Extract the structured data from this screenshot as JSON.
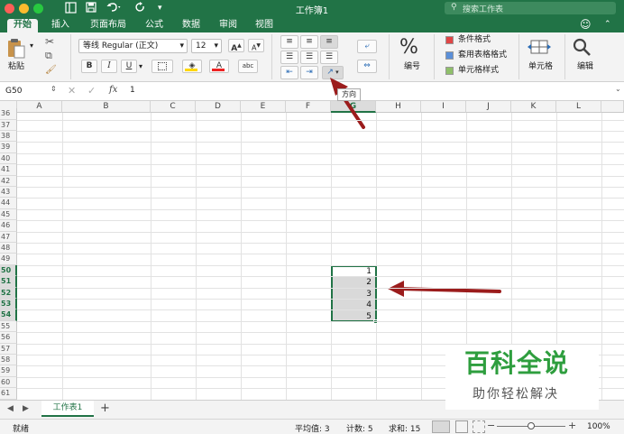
{
  "titlebar": {
    "title": "工作簿1",
    "search_placeholder": "搜索工作表",
    "accent": "#217346"
  },
  "tabs": [
    {
      "label": "开始",
      "active": true
    },
    {
      "label": "插入"
    },
    {
      "label": "页面布局"
    },
    {
      "label": "公式"
    },
    {
      "label": "数据"
    },
    {
      "label": "审阅"
    },
    {
      "label": "视图"
    }
  ],
  "ribbon": {
    "paste_label": "粘贴",
    "font_name": "等线 Regular (正文)",
    "font_size": "12",
    "bold": "B",
    "italic": "I",
    "underline": "U",
    "increase_font": "A",
    "decrease_font": "A",
    "number_label": "编号",
    "percent": "%",
    "cond_format": "条件格式",
    "table_format": "套用表格格式",
    "cell_style": "单元格样式",
    "cells_label": "单元格",
    "editing_label": "编辑",
    "tooltip": "方向"
  },
  "formula_bar": {
    "name_box": "G50",
    "fx": "fx",
    "value": "1"
  },
  "grid": {
    "columns": [
      "A",
      "B",
      "C",
      "D",
      "E",
      "F",
      "G",
      "H",
      "I",
      "J",
      "K",
      "L"
    ],
    "rows": [
      "36",
      "37",
      "38",
      "39",
      "40",
      "41",
      "42",
      "43",
      "44",
      "45",
      "46",
      "47",
      "48",
      "49",
      "50",
      "51",
      "52",
      "53",
      "54",
      "55",
      "56",
      "57",
      "58",
      "59",
      "60",
      "61"
    ],
    "selected_rows": [
      "50",
      "51",
      "52",
      "53",
      "54"
    ],
    "selected_column": "G",
    "values": [
      "1",
      "2",
      "3",
      "4",
      "5"
    ]
  },
  "sheetbar": {
    "sheet_tab": "工作表1",
    "add": "+"
  },
  "statusbar": {
    "ready": "就绪",
    "average": "平均值: 3",
    "count": "计数: 5",
    "sum": "求和: 15",
    "zoom": "100%",
    "minus": "−",
    "plus": "+"
  },
  "watermark": {
    "title": "百科全说",
    "subtitle": "助你轻松解决",
    "color": "#2e9e3e"
  }
}
